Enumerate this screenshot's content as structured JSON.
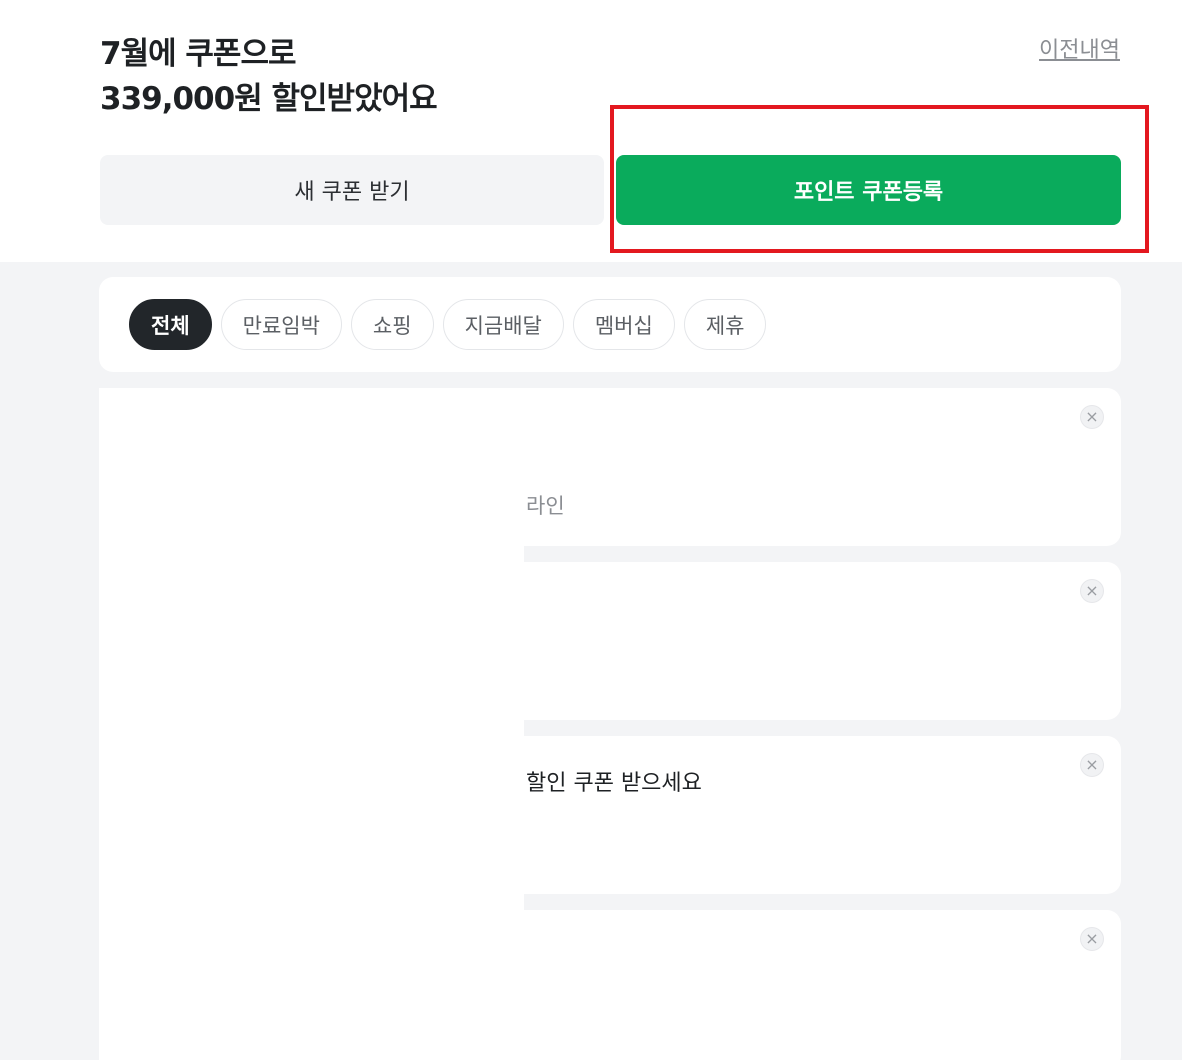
{
  "header": {
    "headline_line1": "7월에 쿠폰으로",
    "headline_line2": "339,000원 할인받았어요",
    "history_link": "이전내역"
  },
  "actions": {
    "new_coupon": "새 쿠폰 받기",
    "register_coupon": "포인트 쿠폰등록"
  },
  "filters": {
    "chips": [
      "전체",
      "만료임박",
      "쇼핑",
      "지금배달",
      "멤버십",
      "제휴"
    ],
    "active": "전체"
  },
  "coupons": [
    {
      "text": "라인",
      "close_icon": "close-icon"
    },
    {
      "text": "",
      "close_icon": "close-icon"
    },
    {
      "text": "할인 쿠폰 받으세요",
      "close_icon": "close-icon"
    },
    {
      "text": "",
      "close_icon": "close-icon"
    }
  ],
  "colors": {
    "accent_green": "#0aab5c",
    "highlight_red": "#e3181f",
    "active_chip": "#22262a"
  }
}
